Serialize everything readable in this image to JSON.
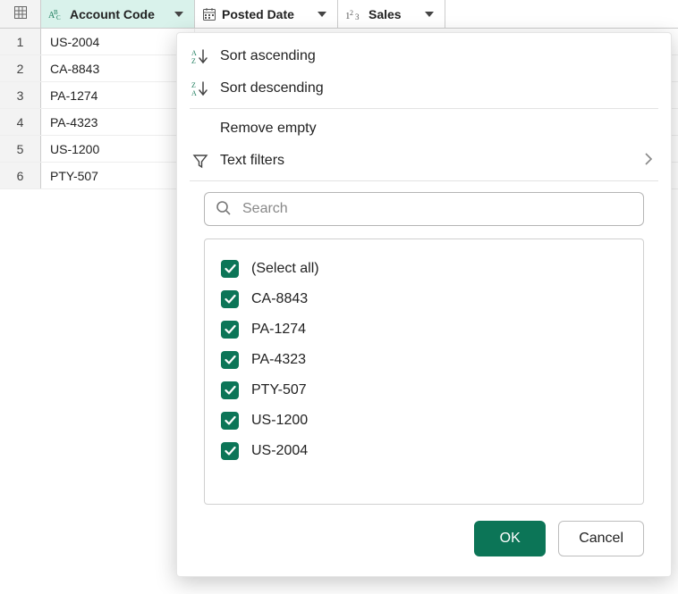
{
  "columns": [
    {
      "label": "Account Code",
      "type": "text"
    },
    {
      "label": "Posted Date",
      "type": "date"
    },
    {
      "label": "Sales",
      "type": "number"
    }
  ],
  "rows": [
    {
      "n": "1",
      "account": "US-2004"
    },
    {
      "n": "2",
      "account": "CA-8843"
    },
    {
      "n": "3",
      "account": "PA-1274"
    },
    {
      "n": "4",
      "account": "PA-4323"
    },
    {
      "n": "5",
      "account": "US-1200"
    },
    {
      "n": "6",
      "account": "PTY-507"
    }
  ],
  "menu": {
    "sort_asc": "Sort ascending",
    "sort_desc": "Sort descending",
    "remove_empty": "Remove empty",
    "text_filters": "Text filters"
  },
  "search_placeholder": "Search",
  "filter_values": [
    "(Select all)",
    "CA-8843",
    "PA-1274",
    "PA-4323",
    "PTY-507",
    "US-1200",
    "US-2004"
  ],
  "buttons": {
    "ok": "OK",
    "cancel": "Cancel"
  },
  "colors": {
    "accent": "#0c7557"
  }
}
